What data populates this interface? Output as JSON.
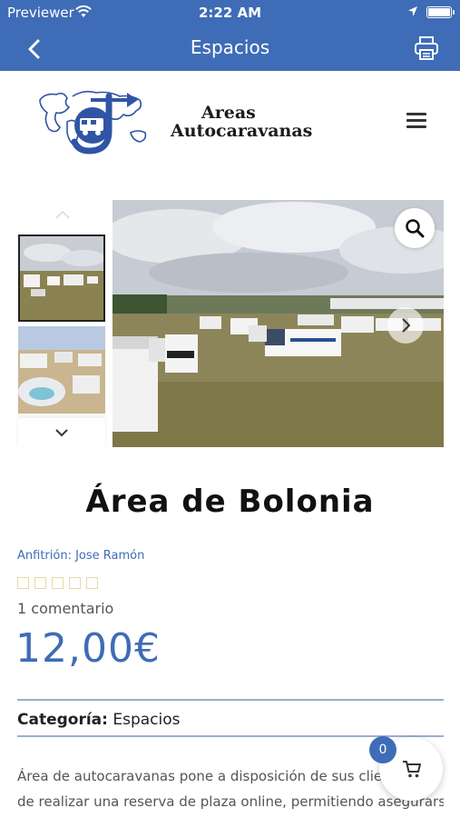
{
  "status_bar": {
    "carrier": "Previewer",
    "time": "2:22 AM",
    "wifi_icon": "wifi-icon",
    "location_icon": "location-arrow-icon",
    "battery_icon": "battery-full-icon"
  },
  "nav": {
    "title": "Espacios",
    "back_icon": "chevron-left-icon",
    "print_icon": "printer-icon"
  },
  "header": {
    "logo_line1": "Areas",
    "logo_line2": "Autocaravanas",
    "menu_icon": "hamburger-menu-icon"
  },
  "gallery": {
    "thumbnails_count": 2,
    "zoom_icon": "search-icon",
    "next_icon": "chevron-right-icon"
  },
  "product": {
    "title": "Área de Bolonia",
    "host": "Anfitrión: Jose Ramón",
    "rating": 0,
    "rating_max": 5,
    "comments": "1 comentario",
    "price": "12,00€",
    "category_label": "Categoría:",
    "category_value": "Espacios",
    "description_line1": "Área de autocaravanas pone a disposición de sus clientes la p",
    "description_line2": "de realizar una reserva de plaza online, permitiendo asegurarse"
  },
  "cart": {
    "count": "0",
    "icon": "shopping-cart-icon"
  },
  "colors": {
    "primary": "#3f6cb6",
    "divider": "#9aaed0",
    "star_empty": "#e4d9a6"
  }
}
